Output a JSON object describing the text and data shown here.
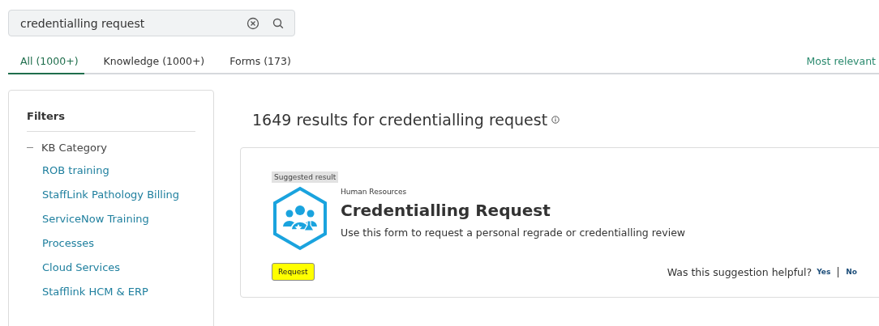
{
  "search": {
    "value": "credentialling request"
  },
  "tabs": [
    {
      "label": "All (1000+)",
      "selected": true
    },
    {
      "label": "Knowledge (1000+)",
      "selected": false
    },
    {
      "label": "Forms (173)",
      "selected": false
    }
  ],
  "sort": {
    "label": "Most relevant"
  },
  "filters": {
    "title": "Filters",
    "group": {
      "label": "KB Category",
      "expanded": true,
      "items": [
        "ROB training",
        "StaffLink Pathology Billing",
        "ServiceNow Training",
        "Processes",
        "Cloud Services",
        "Stafflink HCM & ERP"
      ]
    }
  },
  "results_heading": "1649 results for credentialling request",
  "suggestion": {
    "badge": "Suggested result",
    "category": "Human Resources",
    "title": "Credentialling Request",
    "description": "Use this form to request a personal regrade or credentialling review",
    "action": "Request",
    "feedback": {
      "question": "Was this suggestion helpful?",
      "options": [
        "Yes",
        "No"
      ]
    }
  }
}
